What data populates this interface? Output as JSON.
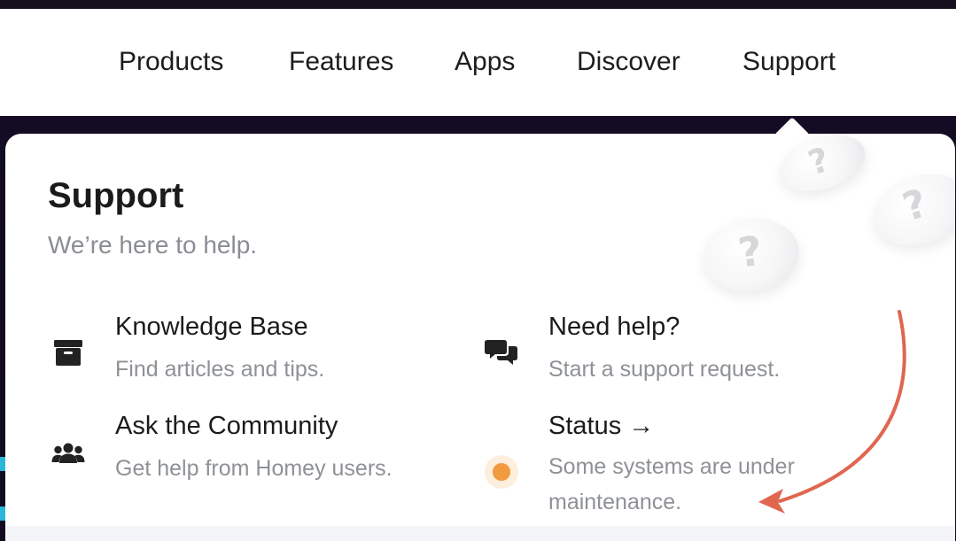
{
  "nav": {
    "items": [
      {
        "label": "Products"
      },
      {
        "label": "Features"
      },
      {
        "label": "Apps"
      },
      {
        "label": "Discover"
      },
      {
        "label": "Support"
      }
    ]
  },
  "panel": {
    "title": "Support",
    "subtitle": "We’re here to help.",
    "items": {
      "knowledge_base": {
        "title": "Knowledge Base",
        "desc": "Find articles and tips.",
        "icon": "archive-box-icon"
      },
      "community": {
        "title": "Ask the Community",
        "desc": "Get help from Homey users.",
        "icon": "users-group-icon"
      },
      "need_help": {
        "title": "Need help?",
        "desc": "Start a support request.",
        "icon": "chat-bubbles-icon"
      },
      "status": {
        "title": "Status →",
        "desc_line1": "Some systems are under",
        "desc_line2": "maintenance.",
        "icon": "status-dot-icon"
      }
    },
    "decor": {
      "qmark": "?"
    }
  },
  "colors": {
    "accent_arrow": "#e06650",
    "status_orange": "#f19a3e",
    "text_dark": "#1b1b1d",
    "text_muted": "#8e9196",
    "background_dark": "#120a1f"
  }
}
